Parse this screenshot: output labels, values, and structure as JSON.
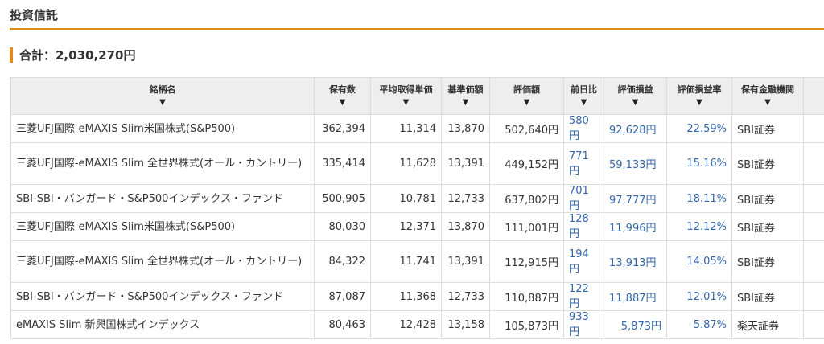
{
  "section_title": "投資信託",
  "total_label": "合計：2,030,270円",
  "colors": {
    "accent": "#e08a22",
    "link_blue": "#3366aa",
    "header_bg": "#eeeeee"
  },
  "sort_icon": "▼",
  "columns": [
    "銘柄名",
    "保有数",
    "平均取得単価",
    "基準価額",
    "評価額",
    "前日比",
    "評価損益",
    "評価損益率",
    "保有金融機関"
  ],
  "rows": [
    {
      "name": "三菱UFJ国際-eMAXIS Slim米国株式(S&P500)",
      "qty": "362,394",
      "avg_cost": "11,314",
      "nav": "13,870",
      "value": "502,640円",
      "day_change": "580円",
      "gain": "92,628円",
      "gain_rate": "22.59%",
      "broker": "SBI証券"
    },
    {
      "name": "三菱UFJ国際-eMAXIS Slim 全世界株式(オール・カントリー)",
      "qty": "335,414",
      "avg_cost": "11,628",
      "nav": "13,391",
      "value": "449,152円",
      "day_change": "771円",
      "gain": "59,133円",
      "gain_rate": "15.16%",
      "broker": "SBI証券"
    },
    {
      "name": "SBI-SBI・バンガード・S&P500インデックス・ファンド",
      "qty": "500,905",
      "avg_cost": "10,781",
      "nav": "12,733",
      "value": "637,802円",
      "day_change": "701円",
      "gain": "97,777円",
      "gain_rate": "18.11%",
      "broker": "SBI証券"
    },
    {
      "name": "三菱UFJ国際-eMAXIS Slim米国株式(S&P500)",
      "qty": "80,030",
      "avg_cost": "12,371",
      "nav": "13,870",
      "value": "111,001円",
      "day_change": "128円",
      "gain": "11,996円",
      "gain_rate": "12.12%",
      "broker": "SBI証券"
    },
    {
      "name": "三菱UFJ国際-eMAXIS Slim 全世界株式(オール・カントリー)",
      "qty": "84,322",
      "avg_cost": "11,741",
      "nav": "13,391",
      "value": "112,915円",
      "day_change": "194円",
      "gain": "13,913円",
      "gain_rate": "14.05%",
      "broker": "SBI証券"
    },
    {
      "name": "SBI-SBI・バンガード・S&P500インデックス・ファンド",
      "qty": "87,087",
      "avg_cost": "11,368",
      "nav": "12,733",
      "value": "110,887円",
      "day_change": "122円",
      "gain": "11,887円",
      "gain_rate": "12.01%",
      "broker": "SBI証券"
    },
    {
      "name": "eMAXIS Slim 新興国株式インデックス",
      "qty": "80,463",
      "avg_cost": "12,428",
      "nav": "13,158",
      "value": "105,873円",
      "day_change": "933円",
      "gain": "5,873円",
      "gain_rate": "5.87%",
      "broker": "楽天証券"
    }
  ]
}
